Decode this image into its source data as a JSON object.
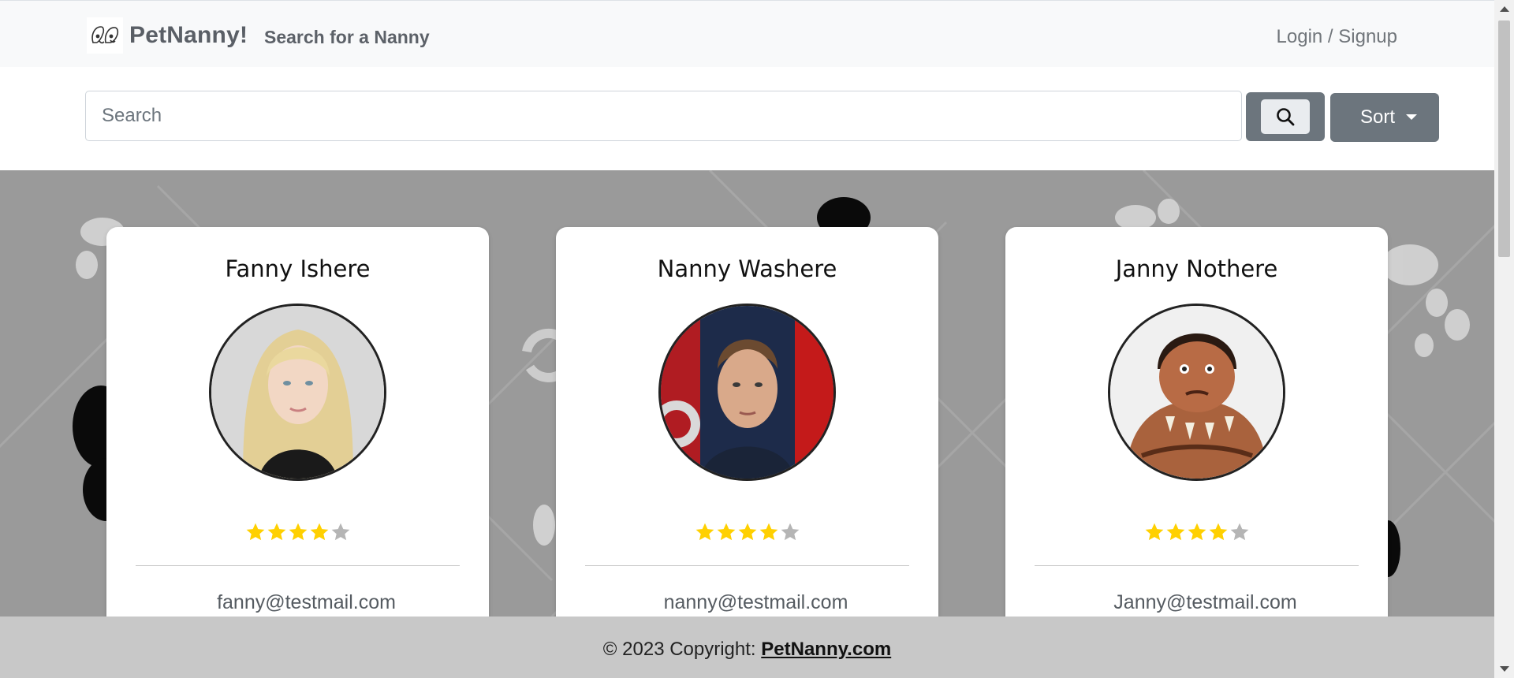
{
  "navbar": {
    "brand_name": "PetNanny!",
    "search_link": "Search for a Nanny",
    "login_link": "Login / Signup"
  },
  "search": {
    "placeholder": "Search",
    "value": "",
    "search_button_icon": "search-icon",
    "sort_label": "Sort"
  },
  "nannies": [
    {
      "name": "Fanny Ishere",
      "email": "fanny@testmail.com",
      "rating": 4,
      "max_rating": 5
    },
    {
      "name": "Nanny Washere",
      "email": "nanny@testmail.com",
      "rating": 4,
      "max_rating": 5
    },
    {
      "name": "Janny Nothere",
      "email": "Janny@testmail.com",
      "rating": 4,
      "max_rating": 5
    }
  ],
  "footer": {
    "copyright": "© 2023 Copyright:",
    "site_link": "PetNanny.com"
  },
  "colors": {
    "star_filled": "#ffd000",
    "star_empty": "#b5b5b5",
    "button_gray": "#6c757d",
    "background_gray": "#9a9a9a",
    "footer_gray": "#c8c8c8"
  }
}
